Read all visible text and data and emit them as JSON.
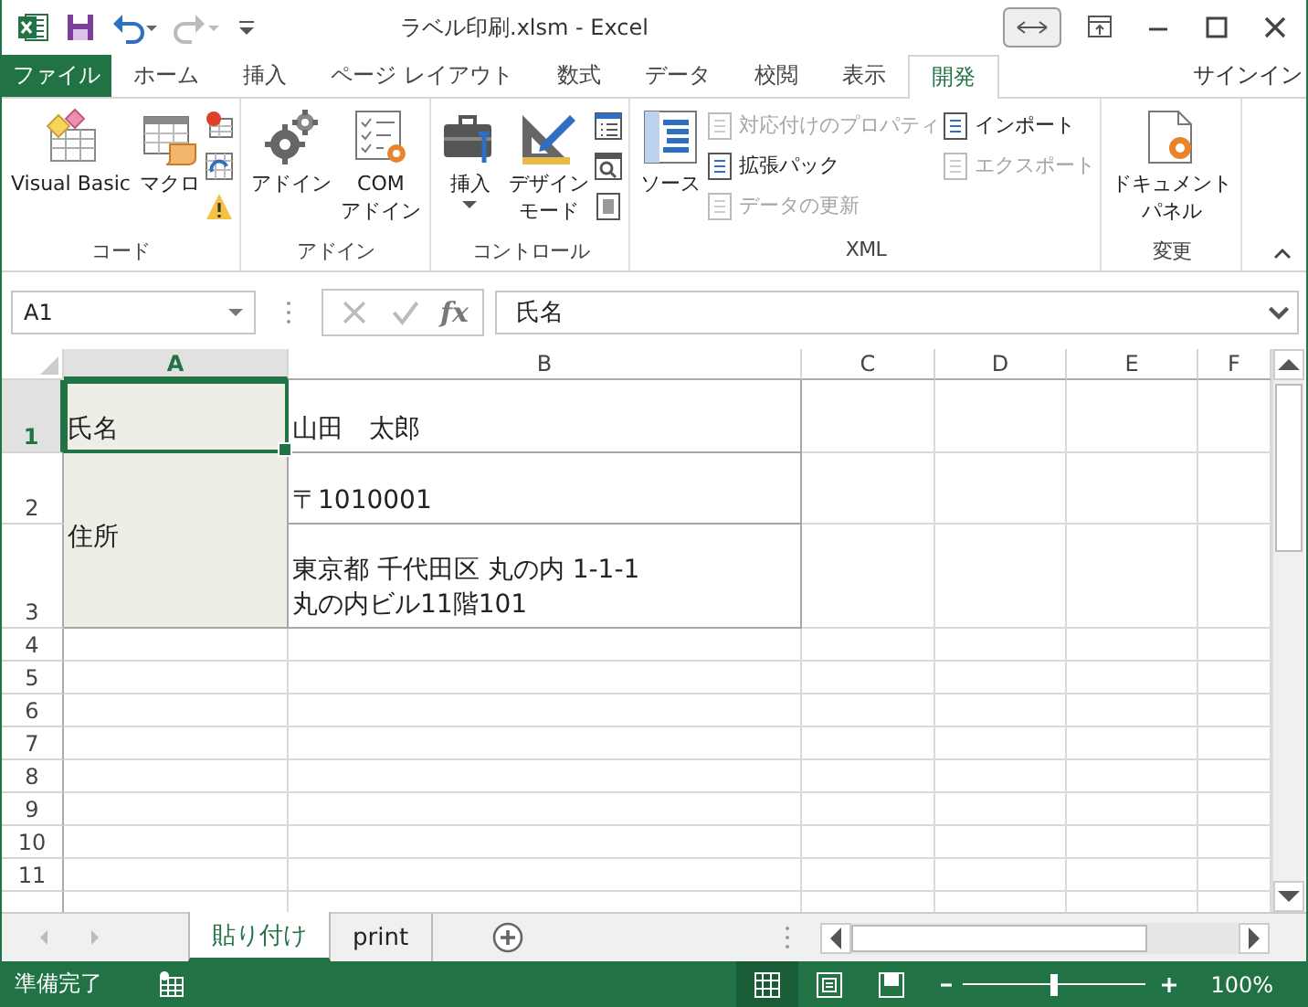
{
  "window": {
    "title": "ラベル印刷.xlsm - Excel"
  },
  "ribbon_tabs": [
    {
      "label": "ファイル",
      "kind": "file",
      "selected": false
    },
    {
      "label": "ホーム",
      "kind": "tab",
      "selected": false
    },
    {
      "label": "挿入",
      "kind": "tab",
      "selected": false
    },
    {
      "label": "ページ レイアウト",
      "kind": "tab",
      "selected": false
    },
    {
      "label": "数式",
      "kind": "tab",
      "selected": false
    },
    {
      "label": "データ",
      "kind": "tab",
      "selected": false
    },
    {
      "label": "校閲",
      "kind": "tab",
      "selected": false
    },
    {
      "label": "表示",
      "kind": "tab",
      "selected": false
    },
    {
      "label": "開発",
      "kind": "tab",
      "selected": true
    }
  ],
  "account": "サインイン",
  "ribbon_groups": [
    {
      "label": "コード",
      "columns": [
        {
          "kind": "large",
          "lines": [
            "Visual Basic"
          ]
        },
        {
          "kind": "large",
          "lines": [
            "マクロ"
          ]
        },
        {
          "kind": "stack",
          "items": [
            {
              "kind": "icon"
            },
            {
              "kind": "icon"
            },
            {
              "kind": "icon"
            }
          ]
        }
      ]
    },
    {
      "label": "アドイン",
      "columns": [
        {
          "kind": "large",
          "lines": [
            "アドイン"
          ]
        },
        {
          "kind": "large",
          "lines": [
            "COM",
            "アドイン"
          ]
        }
      ]
    },
    {
      "label": "コントロール",
      "columns": [
        {
          "kind": "large",
          "lines": [
            "挿入"
          ],
          "dropdown": true
        },
        {
          "kind": "large",
          "lines": [
            "デザイン",
            "モード"
          ]
        },
        {
          "kind": "stack",
          "items": [
            {
              "kind": "icon"
            },
            {
              "kind": "icon"
            },
            {
              "kind": "icon"
            }
          ]
        }
      ]
    },
    {
      "label": "XML",
      "columns": [
        {
          "kind": "large",
          "lines": [
            "ソース"
          ]
        },
        {
          "kind": "stack",
          "items": [
            {
              "kind": "text",
              "label": "対応付けのプロパティ",
              "disabled": true
            },
            {
              "kind": "text",
              "label": "拡張パック",
              "disabled": false
            },
            {
              "kind": "text",
              "label": "データの更新",
              "disabled": true
            }
          ]
        },
        {
          "kind": "stack",
          "items": [
            {
              "kind": "text",
              "label": "インポート",
              "disabled": false
            },
            {
              "kind": "text",
              "label": "エクスポート",
              "disabled": true
            }
          ]
        }
      ]
    },
    {
      "label": "変更",
      "columns": [
        {
          "kind": "large",
          "lines": [
            "ドキュメント",
            "パネル"
          ]
        }
      ]
    }
  ],
  "formula_bar": {
    "name_box": "A1",
    "function_button": "fx",
    "value": "氏名"
  },
  "sheet": {
    "columns": [
      {
        "label": "A",
        "selected": true
      },
      {
        "label": "B",
        "selected": false
      },
      {
        "label": "C",
        "selected": false
      },
      {
        "label": "D",
        "selected": false
      },
      {
        "label": "E",
        "selected": false
      },
      {
        "label": "F",
        "selected": false
      }
    ],
    "rows": [
      {
        "header": "1",
        "selected": true,
        "cells": [
          {
            "text": "氏名",
            "selected": true,
            "shaded": true,
            "outlined": true
          },
          {
            "text": "山田　太郎",
            "selected": false,
            "shaded": false,
            "outlined": true
          }
        ]
      },
      {
        "header": "2",
        "selected": false,
        "cells": [
          {
            "text": "住所",
            "selected": false,
            "shaded": true,
            "outlined": true,
            "merged_down": true
          },
          {
            "text": "〒1010001",
            "selected": false,
            "shaded": false,
            "outlined": true
          }
        ]
      },
      {
        "header": "3",
        "selected": false,
        "cells": [
          {
            "covered": true
          },
          {
            "text": "東京都 千代田区 丸の内 1-1-1\n丸の内ビル11階101",
            "selected": false,
            "shaded": false,
            "outlined": true
          }
        ]
      },
      {
        "header": "4",
        "selected": false,
        "cells": []
      },
      {
        "header": "5",
        "selected": false,
        "cells": []
      },
      {
        "header": "6",
        "selected": false,
        "cells": []
      },
      {
        "header": "7",
        "selected": false,
        "cells": []
      },
      {
        "header": "8",
        "selected": false,
        "cells": []
      },
      {
        "header": "9",
        "selected": false,
        "cells": []
      },
      {
        "header": "10",
        "selected": false,
        "cells": []
      },
      {
        "header": "11",
        "selected": false,
        "cells": []
      }
    ]
  },
  "sheet_tabs": [
    {
      "label": "貼り付け",
      "selected": true
    },
    {
      "label": "print",
      "selected": false
    }
  ],
  "status_bar": {
    "status": "準備完了",
    "views": [
      {
        "selected": true
      },
      {
        "selected": false
      },
      {
        "selected": false
      }
    ],
    "zoom": {
      "level": 0.5,
      "reading": "100%"
    }
  }
}
